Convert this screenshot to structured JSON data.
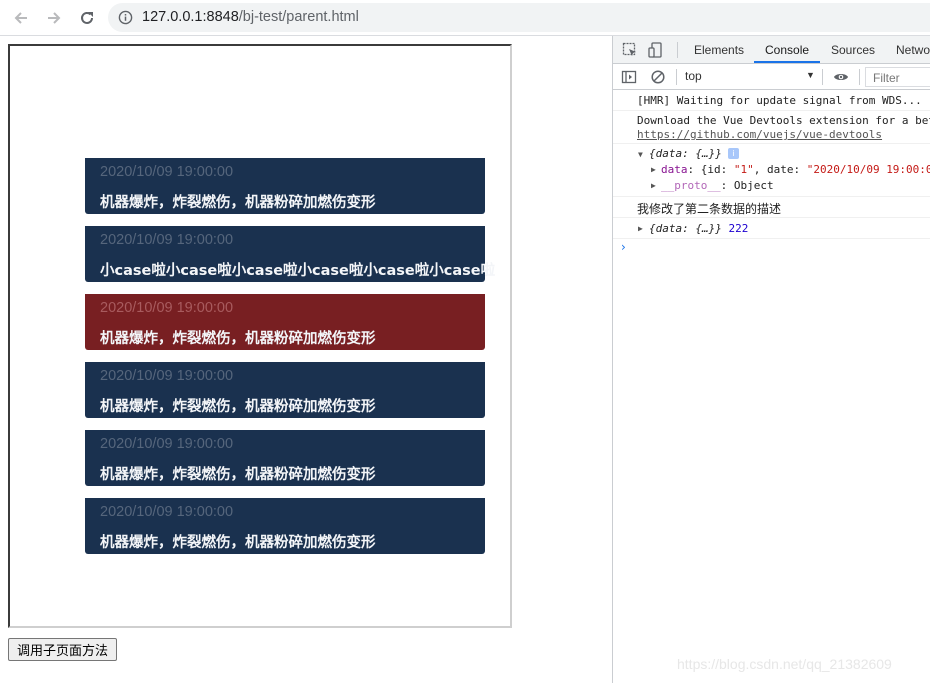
{
  "browser": {
    "url_host": "127.0.0.1:8848",
    "url_path": "/bj-test/parent.html"
  },
  "page": {
    "cards": [
      {
        "date": "2020/10/09 19:00:00",
        "desc": "机器爆炸，炸裂燃伤，机器粉碎加燃伤变形",
        "variant": "dark"
      },
      {
        "date": "2020/10/09 19:00:00",
        "desc": "小case啦小case啦小case啦小case啦小case啦小case啦",
        "variant": "dark"
      },
      {
        "date": "2020/10/09 19:00:00",
        "desc": "机器爆炸，炸裂燃伤，机器粉碎加燃伤变形",
        "variant": "danger"
      },
      {
        "date": "2020/10/09 19:00:00",
        "desc": "机器爆炸，炸裂燃伤，机器粉碎加燃伤变形",
        "variant": "dark"
      },
      {
        "date": "2020/10/09 19:00:00",
        "desc": "机器爆炸，炸裂燃伤，机器粉碎加燃伤变形",
        "variant": "dark"
      },
      {
        "date": "2020/10/09 19:00:00",
        "desc": "机器爆炸，炸裂燃伤，机器粉碎加燃伤变形",
        "variant": "dark"
      }
    ],
    "call_button_label": "调用子页面方法",
    "colors": {
      "card_dark": "#1a314f",
      "card_danger": "#781f22"
    }
  },
  "devtools": {
    "tabs": [
      "Elements",
      "Console",
      "Sources",
      "Netwo"
    ],
    "active_tab": "Console",
    "context": "top",
    "filter_placeholder": "Filter",
    "logs": {
      "hmr": "[HMR] Waiting for update signal from WDS...",
      "vue_line1": "Download the Vue Devtools extension for a bet",
      "vue_link": "https://github.com/vuejs/vue-devtools",
      "obj1_summary": "{data: {…}}",
      "obj1_data_key": "data",
      "obj1_data_value_prefix": ": {id: ",
      "obj1_id": "\"1\"",
      "obj1_date_key": ", date: ",
      "obj1_date": "\"2020/10/09 19:00:0",
      "proto_key": "__proto__",
      "proto_value": ": Object",
      "chinese_log": "我修改了第二条数据的描述",
      "obj2_summary": "{data: {…}}",
      "obj2_number": "222"
    }
  },
  "watermark": "https://blog.csdn.net/qq_21382609"
}
